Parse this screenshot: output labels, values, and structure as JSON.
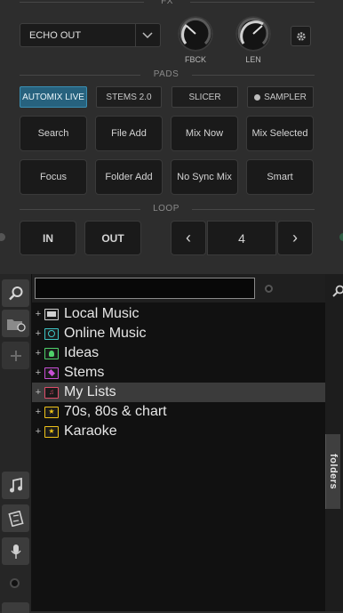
{
  "fx": {
    "section_label": "FX",
    "effect_select": "ECHO OUT",
    "knob1_label": "FBCK",
    "knob2_label": "LEN"
  },
  "pads": {
    "section_label": "PADS",
    "tabs": [
      "AUTOMIX LIVE",
      "STEMS 2.0",
      "SLICER",
      "SAMPLER"
    ],
    "buttons": [
      "Search",
      "File Add",
      "Mix Now",
      "Mix Selected",
      "Focus",
      "Folder Add",
      "No Sync Mix",
      "Smart"
    ]
  },
  "loop": {
    "section_label": "LOOP",
    "in_label": "IN",
    "out_label": "OUT",
    "prev_symbol": "‹",
    "value": "4",
    "next_symbol": "›"
  },
  "browser": {
    "search_value": "",
    "tree": [
      {
        "label": "Local Music",
        "icon": "computer-icon",
        "color": "#d0d0d0"
      },
      {
        "label": "Online Music",
        "icon": "globe-icon",
        "color": "#3fc6c6"
      },
      {
        "label": "Ideas",
        "icon": "lightbulb-icon",
        "color": "#4fd16a"
      },
      {
        "label": "Stems",
        "icon": "stems-icon",
        "color": "#c94fd6"
      },
      {
        "label": "My Lists",
        "icon": "list-icon",
        "color": "#e04d6a"
      },
      {
        "label": "70s, 80s & chart",
        "icon": "star-folder-icon",
        "color": "#f0c419"
      },
      {
        "label": "Karaoke",
        "icon": "star-folder-icon",
        "color": "#f0c419"
      }
    ],
    "selected_index": 4,
    "folders_tab_label": "folders"
  }
}
